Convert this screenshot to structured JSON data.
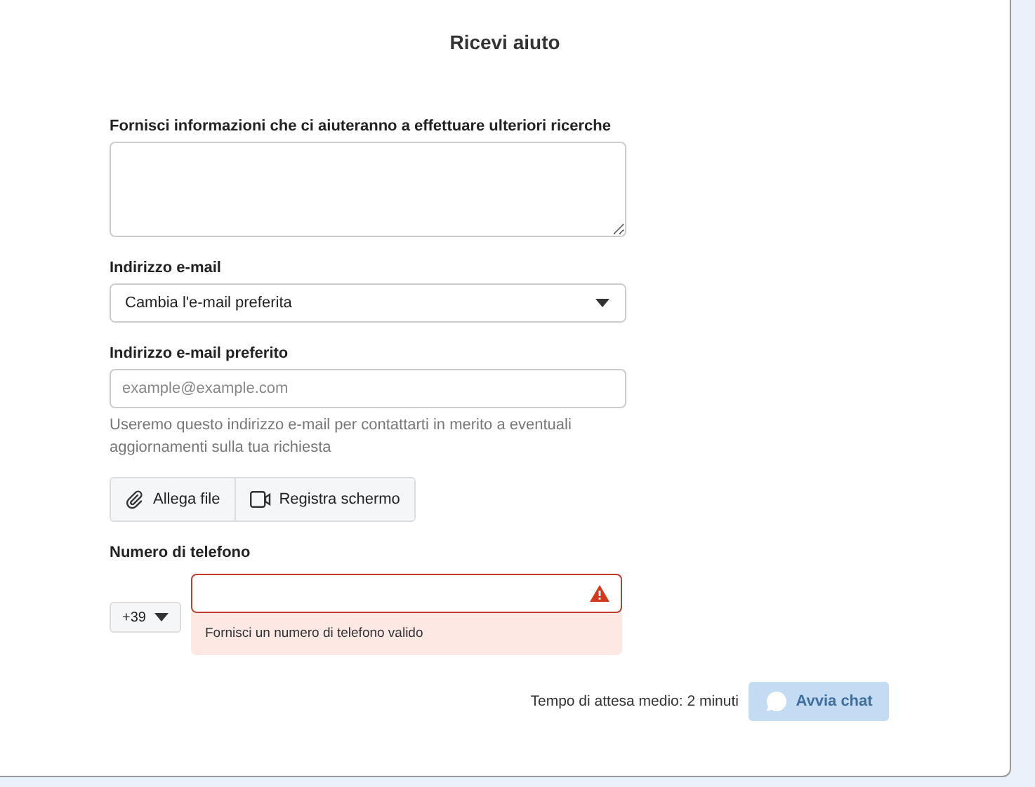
{
  "title": "Ricevi aiuto",
  "details": {
    "label": "Fornisci informazioni che ci aiuteranno a effettuare ulteriori ricerche"
  },
  "email_select": {
    "label": "Indirizzo e-mail",
    "value": "Cambia l'e-mail preferita"
  },
  "preferred_email": {
    "label": "Indirizzo e-mail preferito",
    "placeholder": "example@example.com",
    "helper": "Useremo questo indirizzo e-mail per contattarti in merito a eventuali aggiornamenti sulla tua richiesta"
  },
  "attachments": [
    {
      "kind": "attach",
      "label": "Allega file"
    },
    {
      "kind": "record",
      "label": "Registra schermo"
    }
  ],
  "phone": {
    "label": "Numero di telefono",
    "country_code": "+39",
    "invalid": true,
    "error": "Fornisci un numero di telefono valido"
  },
  "footer": {
    "wait_time": "Tempo di attesa medio: 2 minuti",
    "chat_button": {
      "label": "Avvia chat",
      "disabled": true
    }
  }
}
